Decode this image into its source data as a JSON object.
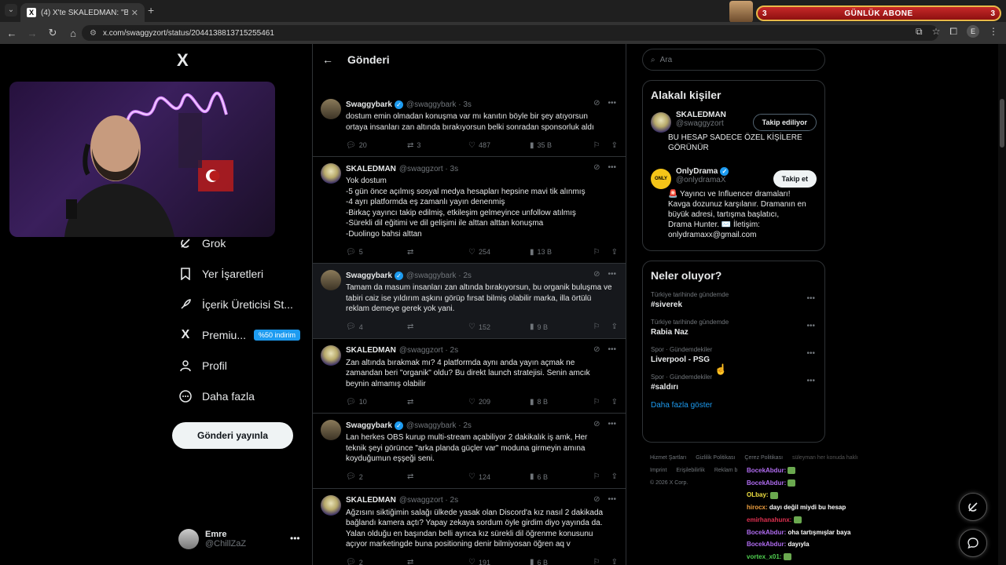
{
  "browser": {
    "tab_title": "(4) X'te SKALEDMAN: \"Bu kız D...",
    "tab_close": "✕",
    "new_tab": "+",
    "url": "x.com/swaggyzort/status/2044138813715255461",
    "profile_letter": "E"
  },
  "stream_overlay": {
    "subscriber_left": "3",
    "subscriber_label": "GÜNLÜK ABONE",
    "subscriber_right": "3"
  },
  "left_nav": {
    "logo": "X",
    "items": [
      {
        "label": "Grok",
        "icon": "grok-icon"
      },
      {
        "label": "Yer İşaretleri",
        "icon": "bookmark-icon"
      },
      {
        "label": "İçerik Üreticisi St...",
        "icon": "rocket-icon"
      },
      {
        "label": "Premiu...",
        "icon": "x-premium-icon",
        "badge": "%50 indirim"
      },
      {
        "label": "Profil",
        "icon": "person-icon"
      },
      {
        "label": "Daha fazla",
        "icon": "more-circle-icon"
      }
    ],
    "post_button": "Gönderi yayınla",
    "account": {
      "name": "Emre",
      "handle": "@ChillZaZ",
      "more": "•••"
    }
  },
  "main": {
    "header_title": "Gönderi",
    "tweets": [
      {
        "name": "Swaggybark",
        "verified": true,
        "handle": "@swaggybark · 3s",
        "text": "dostum emin olmadan konuşma var mı kanıtın böyle bir şey atıyorsun\nortaya insanları zan altında bırakıyorsun belki sonradan sponsorluk aldı",
        "replies": "20",
        "reposts": "3",
        "likes": "487",
        "views": "35 B",
        "avatar": "sg",
        "highlight": false
      },
      {
        "name": "SKALEDMAN",
        "verified": false,
        "handle": "@swaggzort · 3s",
        "text": "Yok dostum\n-5 gün önce açılmış sosyal medya hesapları hepsine mavi tik alınmış\n-4 ayrı platformda eş zamanlı yayın denenmiş\n-Birkaç yayıncı takip edilmiş, etkileşim gelmeyince unfollow atılmış\n-Sürekli dil eğitimi ve dil gelişimi ile alttan alttan konuşma\n-Duolingo bahsi alttan",
        "replies": "5",
        "reposts": "",
        "likes": "254",
        "views": "13 B",
        "avatar": "sk",
        "highlight": false
      },
      {
        "name": "Swaggybark",
        "verified": true,
        "handle": "@swaggybark · 2s",
        "text": "Tamam da masum insanları zan altında bırakıyorsun, bu organik buluşma ve\ntabiri caiz ise yıldırım aşkını görüp fırsat bilmiş olabilir marka, illa örtülü\nreklam demeye gerek yok yani.",
        "replies": "4",
        "reposts": "",
        "likes": "152",
        "views": "9 B",
        "avatar": "sg",
        "highlight": true
      },
      {
        "name": "SKALEDMAN",
        "verified": false,
        "handle": "@swaggzort · 2s",
        "text": "Zan altında bırakmak mı? 4 platformda aynı anda yayın açmak ne\nzamandan beri \"organik\" oldu? Bu direkt launch stratejisi. Senin amcık\nbeynin almamış olabilir",
        "replies": "10",
        "reposts": "",
        "likes": "209",
        "views": "8 B",
        "avatar": "sk",
        "highlight": false
      },
      {
        "name": "Swaggybark",
        "verified": true,
        "handle": "@swaggybark · 2s",
        "text": "Lan herkes OBS kurup multi-stream açabiliyor 2 dakikalık iş amk, Her\nteknik şeyi görünce \"arka planda güçler var\" moduna girmeyin amına\nkoyduğumun eşşeği seni.",
        "replies": "2",
        "reposts": "",
        "likes": "124",
        "views": "6 B",
        "avatar": "sg",
        "highlight": false
      },
      {
        "name": "SKALEDMAN",
        "verified": false,
        "handle": "@swaggzort · 2s",
        "text": "Ağzısını siktiğimin salağı ülkede yasak olan Discord'a kız nasıl 2 dakikada\nbağlandı kamera açtı? Yapay zekaya sordum öyle girdim diyo yayında da.\nYalan olduğu en başından belli ayrıca kız sürekli dil öğrenme konusunu\naçıyor marketingde buna positioning denir bilmiyosan öğren aq v",
        "replies": "2",
        "reposts": "",
        "likes": "191",
        "views": "6 B",
        "avatar": "sk",
        "highlight": false
      }
    ]
  },
  "right": {
    "search_placeholder": "Ara",
    "related_title": "Alakalı kişiler",
    "people": [
      {
        "name": "SKALEDMAN",
        "handle": "@swaggyzort",
        "button": "Takip ediliyor",
        "bio": "BU HESAP SADECE ÖZEL KİŞİLERE\nGÖRÜNÜR",
        "avatar": "sk",
        "verified": false
      },
      {
        "name": "OnlyDrama",
        "handle": "@onlydramaX",
        "button": "Takip et",
        "bio": "🚨 Yayıncı ve Influencer dramaları!\nKavga dozunuz karşılanır. Dramanın en\nbüyük adresi, tartışma başlatıcı,\nDrama Hunter. ✉️ İletişim:\nonlydramaxx@gmail.com",
        "avatar": "od",
        "verified": true
      }
    ],
    "trends_title": "Neler oluyor?",
    "trends": [
      {
        "context": "Türkiye tarihinde gündemde",
        "name": "#siverek"
      },
      {
        "context": "Türkiye tarihinde gündemde",
        "name": "Rabia Naz"
      },
      {
        "context": "Spor · Gündemdekiler",
        "name": "Liverpool - PSG"
      },
      {
        "context": "Spor · Gündemdekiler",
        "name": "#saldırı"
      }
    ],
    "show_more": "Daha fazla göster",
    "footer": [
      "Hizmet Şartları",
      "Gizlilik Politikası",
      "Çerez Politikası",
      "süleyman her konuda haklı",
      "Imprint",
      "Erişilebilirlik",
      "Reklam b",
      "© 2026 X Corp."
    ]
  },
  "chat": [
    {
      "user": "BocekAbdur:",
      "msg": "",
      "color": "#b06cf0"
    },
    {
      "user": "BocekAbdur:",
      "msg": "",
      "color": "#b06cf0"
    },
    {
      "user": "OLbay:",
      "msg": "",
      "color": "#f0e040"
    },
    {
      "user": "hirocx:",
      "msg": "dayı değil miydi bu hesap",
      "color": "#f0a040"
    },
    {
      "user": "emirhanahunx:",
      "msg": "",
      "color": "#e03050"
    },
    {
      "user": "BocekAbdur:",
      "msg": "oha tartışmışlar baya",
      "color": "#b06cf0"
    },
    {
      "user": "BocekAbdur:",
      "msg": "dayıyla",
      "color": "#b06cf0"
    },
    {
      "user": "vortex_x01:",
      "msg": "",
      "color": "#50d050"
    }
  ]
}
